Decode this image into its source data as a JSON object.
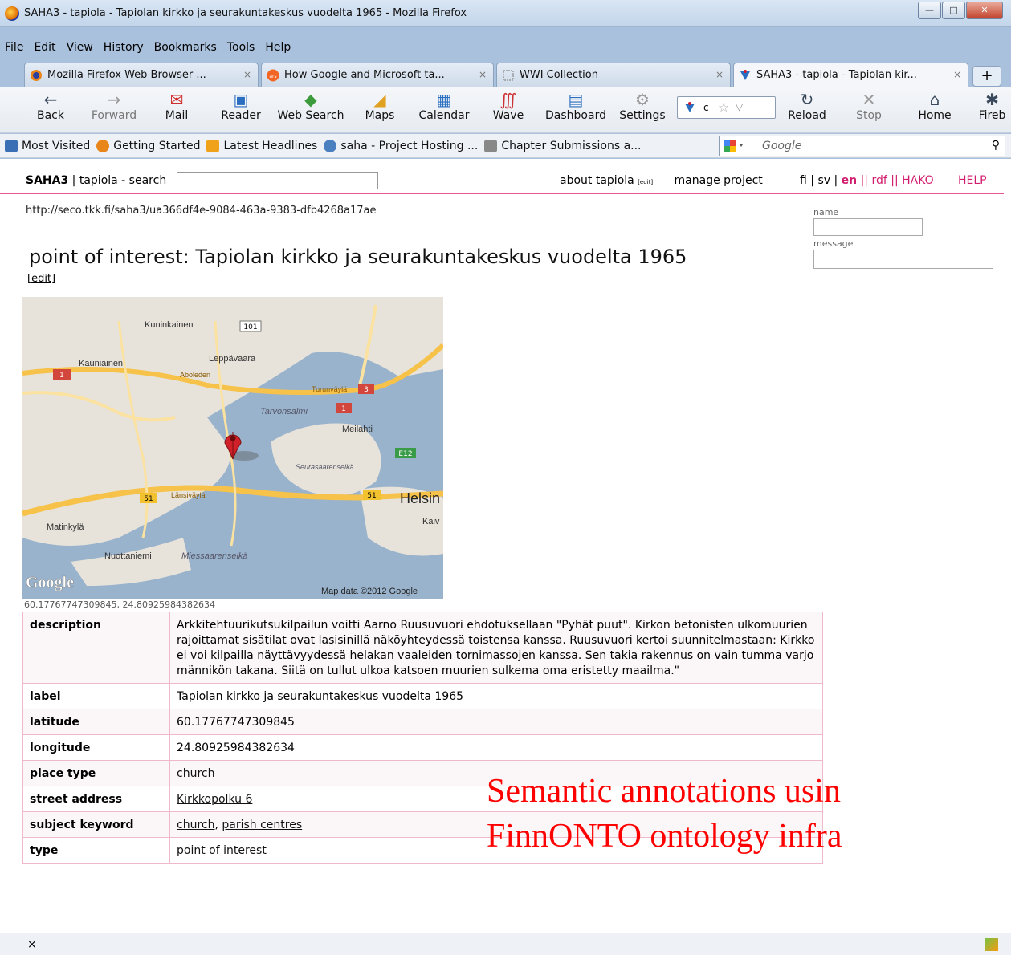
{
  "window": {
    "title": "SAHA3 - tapiola - Tapiolan kirkko ja seurakuntakeskus vuodelta 1965 - Mozilla Firefox",
    "min": "—",
    "max": "□",
    "close": "✕"
  },
  "menu": {
    "items": [
      "File",
      "Edit",
      "View",
      "History",
      "Bookmarks",
      "Tools",
      "Help"
    ]
  },
  "tabs": [
    {
      "label": "Mozilla Firefox Web Browser ...",
      "close": "×"
    },
    {
      "label": "How Google and Microsoft ta...",
      "close": "×"
    },
    {
      "label": "WWI Collection",
      "close": "×"
    },
    {
      "label": "SAHA3 - tapiola - Tapiolan kir...",
      "close": "×"
    }
  ],
  "new_tab": "+",
  "toolbar": {
    "back": "Back",
    "forward": "Forward",
    "mail": "Mail",
    "reader": "Reader",
    "web_search": "Web Search",
    "maps": "Maps",
    "calendar": "Calendar",
    "wave": "Wave",
    "dashboard": "Dashboard",
    "settings": "Settings",
    "reload": "Reload",
    "stop": "Stop",
    "home": "Home",
    "fireb": "Fireb",
    "url_fragment": "c"
  },
  "bookmarks": [
    {
      "label": "Most Visited",
      "color": "#3a6fb5"
    },
    {
      "label": "Getting Started",
      "color": "#e8861a"
    },
    {
      "label": "Latest Headlines",
      "color": "#f0a21b"
    },
    {
      "label": "saha - Project Hosting ...",
      "color": "#4a7fc0"
    },
    {
      "label": "Chapter Submissions a...",
      "color": "#888888"
    }
  ],
  "search": {
    "placeholder": "Google"
  },
  "page": {
    "brand_saha": "SAHA3",
    "brand_sep": " | ",
    "brand_project": "tapiola",
    "brand_suffix": " - search",
    "about": "about tapiola",
    "about_badge": "[edit]",
    "manage": "manage project",
    "lang_fi": "fi",
    "lang_sv": "sv",
    "lang_en": "en",
    "lang_rdf": "rdf",
    "lang_hako": "HAKO",
    "help": "HELP",
    "uri": "http://seco.tkk.fi/saha3/ua366df4e-9084-463a-9383-dfb4268a17ae",
    "name_label": "name",
    "message_label": "message",
    "title": "point of interest: Tapiolan kirkko ja seurakuntakeskus vuodelta 1965",
    "edit": "[edit]",
    "coords": "60.17767747309845, 24.80925984382634"
  },
  "map": {
    "labels": [
      "Kuninkainen",
      "Leppävaara",
      "Kauniainen",
      "Aboleden",
      "Turunväylä",
      "Tarvonsalmi",
      "Meilahti",
      "Seurasaarenselkä",
      "Länsiväylä",
      "Helsin",
      "Matinkylä",
      "Nuottaniemi",
      "Miessaarenselkä",
      "Kaiv"
    ],
    "shields": [
      "101",
      "1",
      "3",
      "1",
      "E12",
      "51",
      "51"
    ],
    "google": "Google",
    "copyright": "Map data ©2012 Google",
    "marker_color": "#d0202a"
  },
  "properties": [
    {
      "key": "description",
      "value": "Arkkitehtuurikutsukilpailun voitti Aarno Ruusuvuori ehdotuksellaan \"Pyhät puut\". Kirkon betonisten ulkomuurien rajoittamat sisätilat ovat lasisinillä näköyhteydessä toistensa kanssa. Ruusuvuori kertoi suunnitelmastaan: Kirkko ei voi kilpailla näyttävyydessä helakan vaaleiden tornimassojen kanssa. Sen takia rakennus on vain tumma varjo männikön takana. Siitä on tullut ulkoa katsoen muurien sulkema oma eristetty maailma.\""
    },
    {
      "key": "label",
      "value": "Tapiolan kirkko ja seurakuntakeskus vuodelta 1965"
    },
    {
      "key": "latitude",
      "value": "60.17767747309845"
    },
    {
      "key": "longitude",
      "value": "24.80925984382634"
    },
    {
      "key": "place type",
      "link": "church"
    },
    {
      "key": "street address",
      "link": "Kirkkopolku 6"
    },
    {
      "key": "subject keyword",
      "link": "church",
      "sep": ", ",
      "link2": "parish centres"
    },
    {
      "key": "type",
      "link": "point of interest"
    }
  ],
  "overlay": {
    "line1": "Semantic annotations usin",
    "line2": "FinnONTO ontology infra",
    "color": "#ff0000"
  },
  "status": {
    "close": "×"
  }
}
